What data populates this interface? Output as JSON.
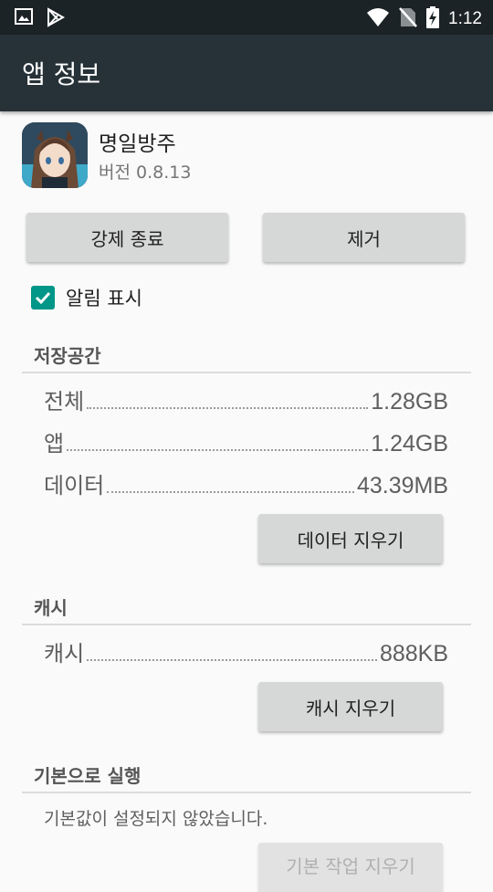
{
  "status_bar": {
    "time": "1:12",
    "left_icons": [
      "image-icon",
      "play-store-icon"
    ],
    "right_icons": [
      "wifi-icon",
      "no-sim-icon",
      "battery-charging-icon"
    ]
  },
  "app_bar": {
    "title": "앱 정보"
  },
  "app": {
    "name": "명일방주",
    "version": "버전 0.8.13"
  },
  "buttons": {
    "force_stop": "강제 종료",
    "uninstall": "제거"
  },
  "notifications": {
    "label": "알림 표시",
    "checked": true
  },
  "storage": {
    "title": "저장공간",
    "rows": [
      {
        "label": "전체",
        "value": "1.28GB"
      },
      {
        "label": "앱",
        "value": "1.24GB"
      },
      {
        "label": "데이터",
        "value": "43.39MB"
      }
    ],
    "clear_data_button": "데이터 지우기"
  },
  "cache": {
    "title": "캐시",
    "rows": [
      {
        "label": "캐시",
        "value": "888KB"
      }
    ],
    "clear_cache_button": "캐시 지우기"
  },
  "launch_default": {
    "title": "기본으로 실행",
    "description": "기본값이 설정되지 않았습니다.",
    "clear_defaults_button": "기본 작업 지우기"
  },
  "colors": {
    "status_bar": "#1c2326",
    "app_bar": "#263238",
    "accent": "#009688",
    "button": "#d6d7d7"
  }
}
